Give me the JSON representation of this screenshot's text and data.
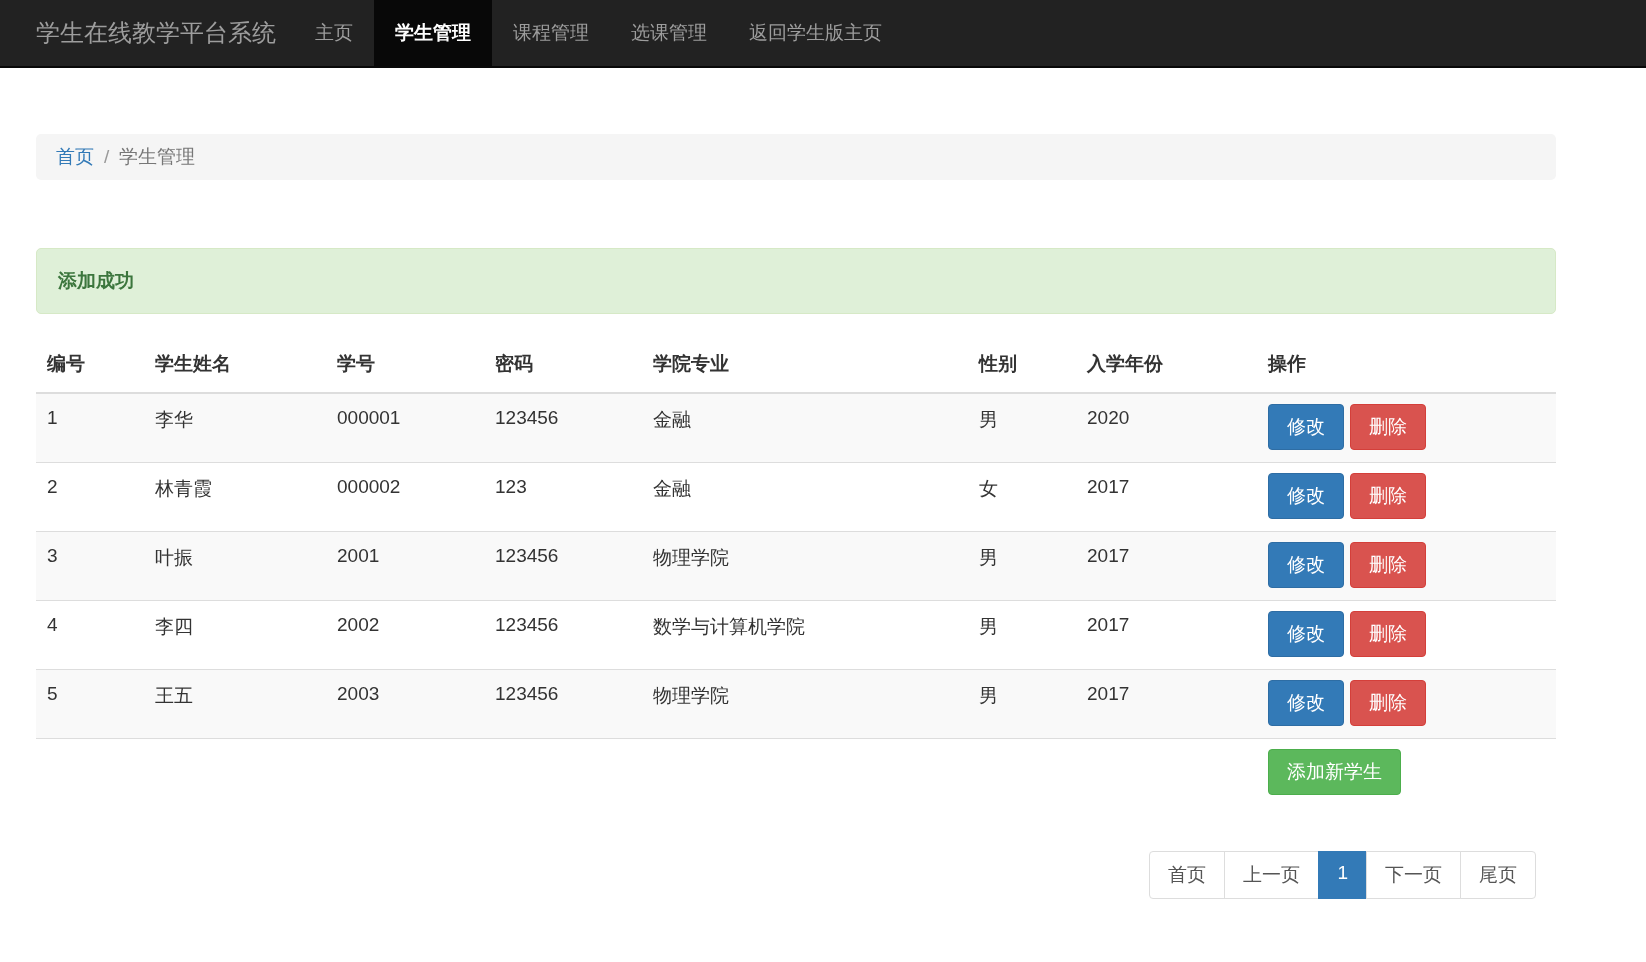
{
  "navbar": {
    "brand": "学生在线教学平台系统",
    "items": [
      {
        "label": "主页",
        "selected": false
      },
      {
        "label": "学生管理",
        "selected": true
      },
      {
        "label": "课程管理",
        "selected": false
      },
      {
        "label": "选课管理",
        "selected": false
      },
      {
        "label": "返回学生版主页",
        "selected": false
      }
    ]
  },
  "breadcrumb": {
    "items": [
      {
        "label": "首页",
        "kind": "link"
      },
      {
        "label": "学生管理",
        "kind": "current"
      }
    ],
    "separator": "/"
  },
  "alert": {
    "text": "添加成功"
  },
  "table": {
    "columns": [
      "编号",
      "学生姓名",
      "学号",
      "密码",
      "学院专业",
      "性别",
      "入学年份",
      "操作"
    ],
    "rows": [
      {
        "cells": [
          "1",
          "李华",
          "000001",
          "123456",
          "金融",
          "男",
          "2020"
        ],
        "actions": [
          "修改",
          "删除"
        ]
      },
      {
        "cells": [
          "2",
          "林青霞",
          "000002",
          "123",
          "金融",
          "女",
          "2017"
        ],
        "actions": [
          "修改",
          "删除"
        ]
      },
      {
        "cells": [
          "3",
          "叶振",
          "2001",
          "123456",
          "物理学院",
          "男",
          "2017"
        ],
        "actions": [
          "修改",
          "删除"
        ]
      },
      {
        "cells": [
          "4",
          "李四",
          "2002",
          "123456",
          "数学与计算机学院",
          "男",
          "2017"
        ],
        "actions": [
          "修改",
          "删除"
        ]
      },
      {
        "cells": [
          "5",
          "王五",
          "2003",
          "123456",
          "物理学院",
          "男",
          "2017"
        ],
        "actions": [
          "修改",
          "删除"
        ]
      }
    ],
    "add_button": "添加新学生"
  },
  "pagination": [
    {
      "label": "首页",
      "selected": false
    },
    {
      "label": "上一页",
      "selected": false
    },
    {
      "label": "1",
      "selected": true
    },
    {
      "label": "下一页",
      "selected": false
    },
    {
      "label": "尾页",
      "selected": false
    }
  ]
}
